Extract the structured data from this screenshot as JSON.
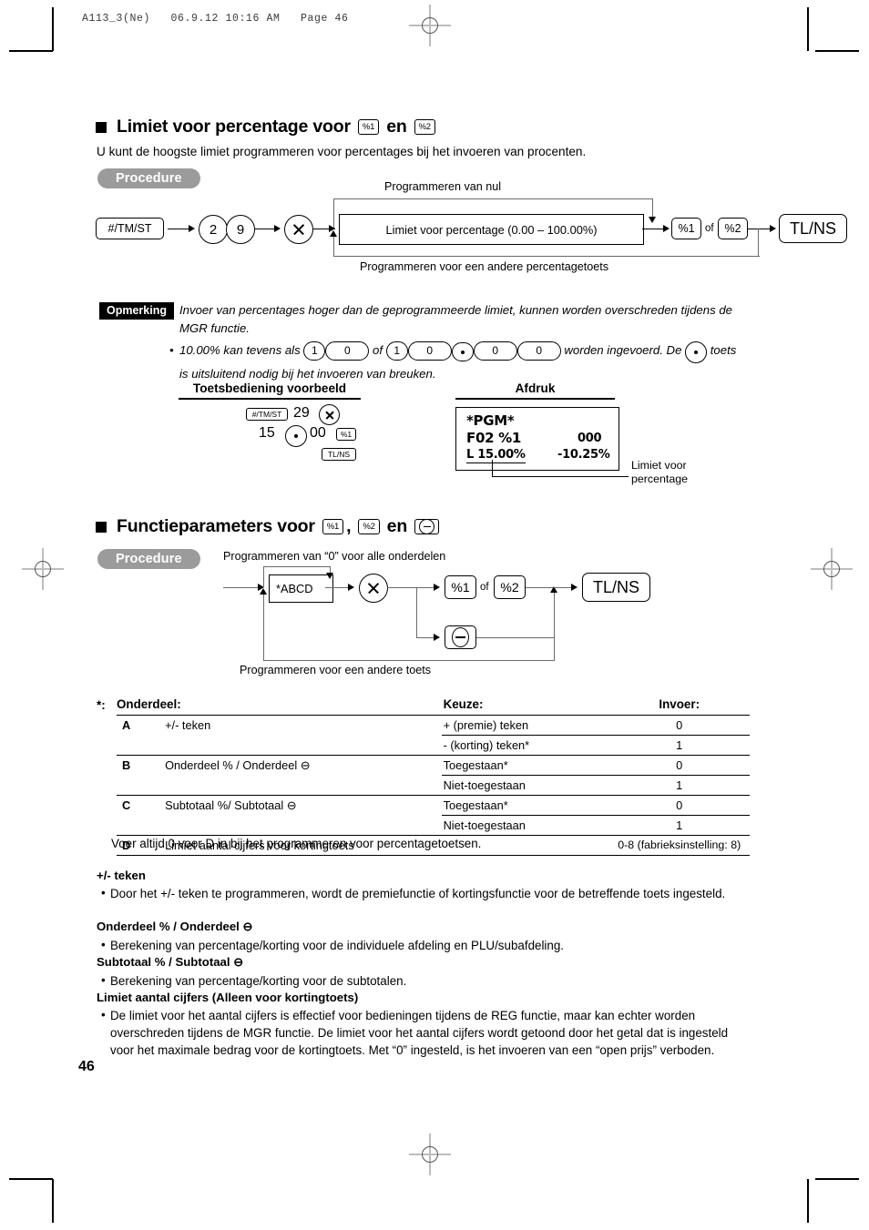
{
  "print_slug": "A113_3(Ne)   06.9.12 10:16 AM   Page 46",
  "page_number": "46",
  "section1": {
    "heading_pre": "Limiet voor percentage voor",
    "heading_key1": "%1",
    "heading_mid": "en",
    "heading_key2": "%2",
    "intro": "U kunt de hoogste limiet programmeren voor percentages bij het invoeren van procenten.",
    "procedure_label": "Procedure",
    "flow": {
      "key_tmst": "#/TM/ST",
      "digit_2": "2",
      "digit_9": "9",
      "top_label": "Programmeren van nul",
      "bottom_label": "Programmeren voor een andere percentagetoets",
      "box_text": "Limiet voor percentage (0.00 – 100.00%)",
      "key_pct1": "%1",
      "of": "of",
      "key_pct2": "%2",
      "key_tlns": "TL/NS"
    },
    "note": {
      "badge": "Opmerking",
      "line1": "Invoer van percentages hoger dan de geprogrammeerde limiet, kunnen worden overschreden tijdens de MGR functie.",
      "line2_a": "10.00% kan tevens als",
      "line2_keys1": [
        "1",
        "0"
      ],
      "line2_of": "of",
      "line2_keys2": [
        "1",
        "0",
        "•",
        "0",
        "0"
      ],
      "line2_b": "worden ingevoerd. De",
      "line2_dot": "•",
      "line2_c": "toets",
      "line2_d": "is uitsluitend nodig bij het invoeren van breuken."
    },
    "example": {
      "col1_title": "Toetsbediening voorbeeld",
      "col2_title": "Afdruk",
      "keys_row1": [
        "#/TM/ST",
        "29",
        "×"
      ],
      "keys_row2": [
        "15",
        "•",
        "00",
        "%1"
      ],
      "keys_row3": [
        "TL/NS"
      ],
      "receipt": {
        "l1": "*PGM*",
        "l2_left": "F02 %1",
        "l2_right": "000",
        "l3_left": "L 15.00%",
        "l3_right": "-10.25%"
      },
      "callout": "Limiet voor\npercentage",
      "callout_line1": "Limiet voor",
      "callout_line2": "percentage"
    }
  },
  "section2": {
    "heading_pre": "Functieparameters voor",
    "heading_key1": "%1",
    "heading_comma": ",",
    "heading_key2": "%2",
    "heading_mid": "en",
    "heading_key3": "⊖",
    "procedure_label": "Procedure",
    "flow": {
      "top_label": "Programmeren van “0” voor alle onderdelen",
      "bottom_label": "Programmeren voor een andere toets",
      "abcd": "*ABCD",
      "key_pct1": "%1",
      "of": "of",
      "key_pct2": "%2",
      "key_minus": "⊖",
      "key_tlns": "TL/NS"
    }
  },
  "table": {
    "star": "*:",
    "headers": [
      "Onderdeel:",
      "Keuze:",
      "Invoer:"
    ],
    "rows": [
      {
        "code": "A",
        "item": "+/- teken",
        "choices": [
          {
            "keuze": "+ (premie) teken",
            "invoer": "0"
          },
          {
            "keuze": "- (korting) teken*",
            "invoer": "1"
          }
        ]
      },
      {
        "code": "B",
        "item": "Onderdeel % / Onderdeel ⊖",
        "choices": [
          {
            "keuze": "Toegestaan*",
            "invoer": "0"
          },
          {
            "keuze": "Niet-toegestaan",
            "invoer": "1"
          }
        ]
      },
      {
        "code": "C",
        "item": "Subtotaal %/ Subtotaal ⊖",
        "choices": [
          {
            "keuze": "Toegestaan*",
            "invoer": "0"
          },
          {
            "keuze": "Niet-toegestaan",
            "invoer": "1"
          }
        ]
      },
      {
        "code": "D",
        "item": "Limiet aantal cijfers voor kortingtoets",
        "choices": [
          {
            "keuze": "",
            "invoer": "0-8 (fabrieksinstelling: 8)"
          }
        ]
      }
    ],
    "footnote": "Voer altijd 0 voor D in bij het programmeren voor percentagetoetsen."
  },
  "notes": [
    {
      "heading": "+/- teken",
      "body": "Door het +/- teken te programmeren, wordt de premiefunctie of kortingsfunctie voor de betreffende toets ingesteld."
    },
    {
      "heading": "Onderdeel % / Onderdeel ⊖",
      "body": "Berekening van percentage/korting voor de individuele afdeling en PLU/subafdeling."
    },
    {
      "heading": "Subtotaal % / Subtotaal ⊖",
      "body": "Berekening van percentage/korting voor de subtotalen."
    },
    {
      "heading": "Limiet aantal cijfers (Alleen voor kortingtoets)",
      "body": "De limiet voor het aantal cijfers is effectief voor bedieningen tijdens de REG functie, maar kan echter worden overschreden tijdens de MGR functie. De limiet voor het aantal cijfers wordt getoond door het getal dat is ingesteld voor het maximale bedrag voor de kortingtoets. Met “0” ingesteld, is het invoeren van een “open prijs” verboden."
    }
  ]
}
